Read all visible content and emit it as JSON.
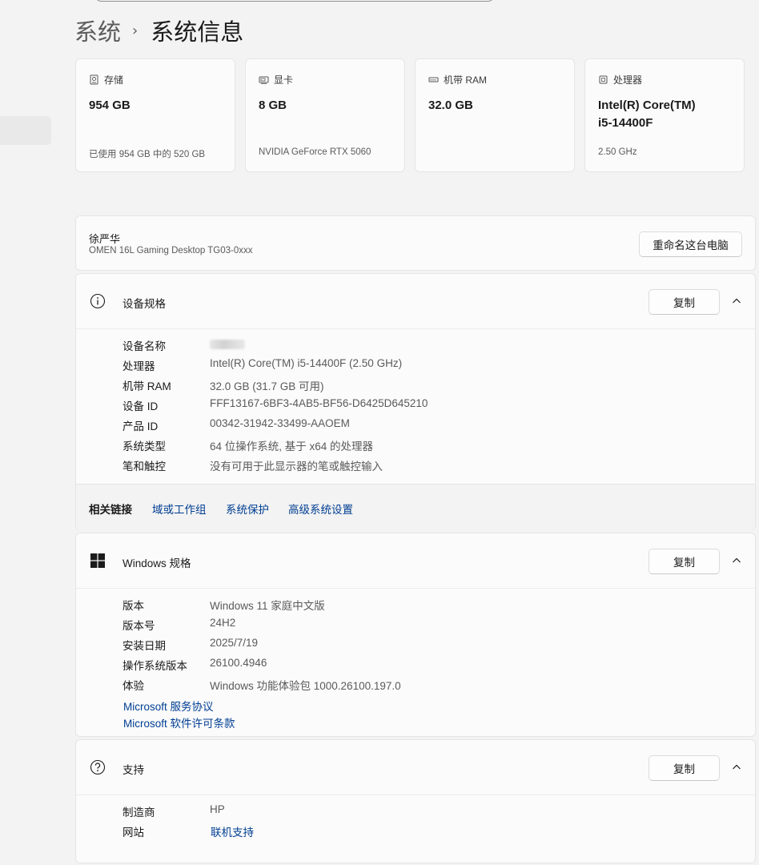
{
  "breadcrumb": {
    "parent": "系统",
    "separator": "›",
    "current": "系统信息"
  },
  "cards": [
    {
      "title": "存储",
      "value": "954 GB",
      "sub": "已使用 954 GB 中的 520 GB",
      "icon": "storage-icon"
    },
    {
      "title": "显卡",
      "value": "8 GB",
      "sub": "NVIDIA GeForce RTX 5060",
      "icon": "graphics-card-icon"
    },
    {
      "title": "机带 RAM",
      "value": "32.0 GB",
      "sub": "",
      "icon": "ram-icon"
    },
    {
      "title": "处理器",
      "value": "Intel(R) Core(TM) i5-14400F",
      "sub": "2.50 GHz",
      "icon": "processor-icon"
    }
  ],
  "pc": {
    "name": "徐严华",
    "model": "OMEN 16L Gaming Desktop TG03-0xxx",
    "rename_label": "重命名这台电脑"
  },
  "device_specs": {
    "title": "设备规格",
    "copy_label": "复制",
    "rows": [
      {
        "label": "设备名称",
        "value": ""
      },
      {
        "label": "处理器",
        "value": "Intel(R) Core(TM) i5-14400F (2.50 GHz)"
      },
      {
        "label": "机带 RAM",
        "value": "32.0 GB (31.7 GB 可用)"
      },
      {
        "label": "设备 ID",
        "value": "FFF13167-6BF3-4AB5-BF56-D6425D645210"
      },
      {
        "label": "产品 ID",
        "value": "00342-31942-33499-AAOEM"
      },
      {
        "label": "系统类型",
        "value": "64 位操作系统, 基于 x64 的处理器"
      },
      {
        "label": "笔和触控",
        "value": "没有可用于此显示器的笔或触控输入"
      }
    ]
  },
  "related": {
    "title": "相关链接",
    "links": [
      "域或工作组",
      "系统保护",
      "高级系统设置"
    ]
  },
  "windows_specs": {
    "title": "Windows 规格",
    "copy_label": "复制",
    "rows": [
      {
        "label": "版本",
        "value": "Windows 11 家庭中文版"
      },
      {
        "label": "版本号",
        "value": "24H2"
      },
      {
        "label": "安装日期",
        "value": "2025/7/19"
      },
      {
        "label": "操作系统版本",
        "value": "26100.4946"
      },
      {
        "label": "体验",
        "value": "Windows 功能体验包 1000.26100.197.0"
      }
    ],
    "links": [
      "Microsoft 服务协议",
      "Microsoft 软件许可条款"
    ]
  },
  "support": {
    "title": "支持",
    "copy_label": "复制",
    "rows": [
      {
        "label": "制造商",
        "value": "HP"
      },
      {
        "label": "网站",
        "value": "联机支持"
      }
    ]
  },
  "colors": {
    "link": "#003e92",
    "background": "#f3f3f3",
    "card": "#fbfbfb"
  }
}
